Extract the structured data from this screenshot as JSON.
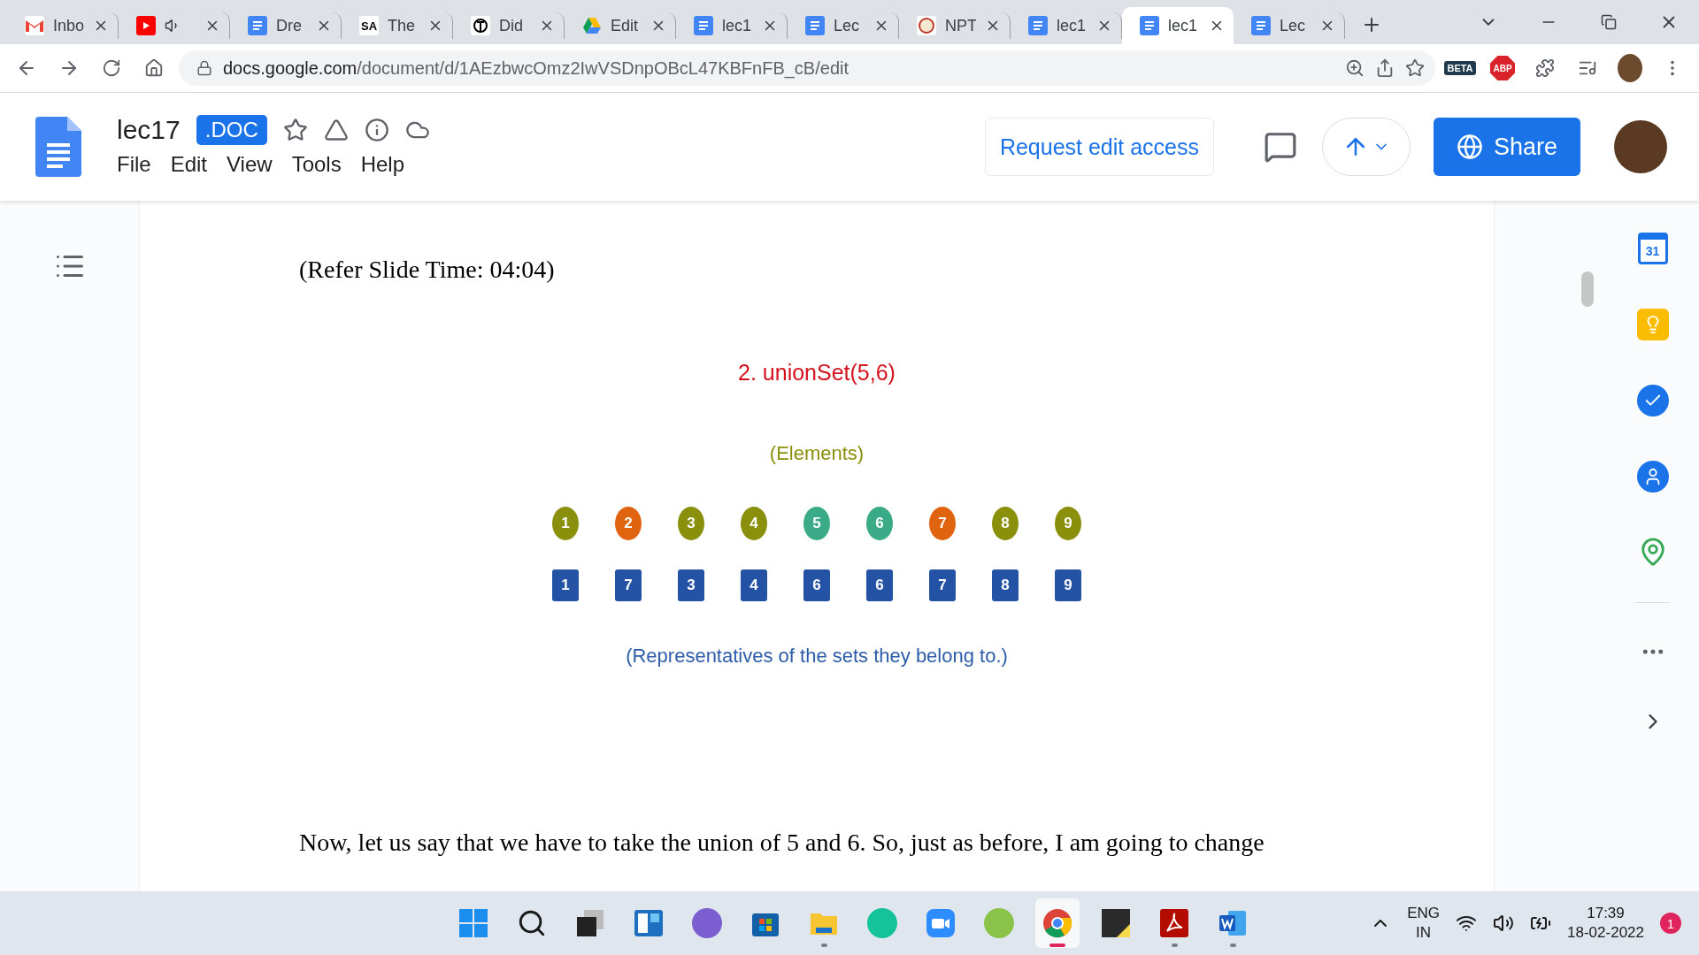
{
  "tabs": [
    {
      "kind": "gmail",
      "label": "Inbo",
      "audio": false,
      "selected": false
    },
    {
      "kind": "youtube",
      "audio": true,
      "selected": false
    },
    {
      "kind": "docs",
      "label": "Dre",
      "audio": false,
      "selected": false
    },
    {
      "kind": "sa",
      "icon_text": "SA",
      "label": "The",
      "audio": false,
      "selected": false
    },
    {
      "kind": "nyt",
      "label": "Did",
      "audio": false,
      "selected": false
    },
    {
      "kind": "drive",
      "label": "Edit",
      "audio": false,
      "selected": false
    },
    {
      "kind": "docs",
      "label": "lec1",
      "audio": false,
      "selected": false
    },
    {
      "kind": "docs",
      "label": "Lec",
      "audio": false,
      "selected": false
    },
    {
      "kind": "nptel",
      "label": "NPT",
      "audio": false,
      "selected": false
    },
    {
      "kind": "docs",
      "label": "lec1",
      "audio": false,
      "selected": false
    },
    {
      "kind": "docs",
      "label": "lec1",
      "audio": false,
      "selected": true
    },
    {
      "kind": "docs",
      "label": "Lec",
      "audio": false,
      "selected": false
    }
  ],
  "address_bar": {
    "host": "docs.google.com",
    "path": "/document/d/1AEzbwcOmz2IwVSDnpOBcL47KBFnFB_cB/edit"
  },
  "extensions": {
    "beta_label": "BETA",
    "abp_label": "ABP"
  },
  "doc_header": {
    "title": "lec17",
    "badge": ".DOC",
    "menu": [
      "File",
      "Edit",
      "View",
      "Tools",
      "Help"
    ],
    "request_button": "Request edit access",
    "share_button": "Share"
  },
  "document": {
    "refer": "(Refer Slide Time: 04:04)",
    "slide": {
      "title": "2. unionSet(5,6)",
      "elements_label": "(Elements)",
      "elements": [
        {
          "label": "1",
          "color": "#8a8f0c"
        },
        {
          "label": "2",
          "color": "#e0630f"
        },
        {
          "label": "3",
          "color": "#8a8f0c"
        },
        {
          "label": "4",
          "color": "#8a8f0c"
        },
        {
          "label": "5",
          "color": "#3aab86"
        },
        {
          "label": "6",
          "color": "#3aab86"
        },
        {
          "label": "7",
          "color": "#e0630f"
        },
        {
          "label": "8",
          "color": "#8a8f0c"
        },
        {
          "label": "9",
          "color": "#8a8f0c"
        }
      ],
      "representatives": [
        "1",
        "7",
        "3",
        "4",
        "6",
        "6",
        "7",
        "8",
        "9"
      ],
      "caption": "(Representatives of the sets they belong to.)"
    },
    "paragraph": [
      "Now, let us say that we have to take the union of 5 and 6. So, just as before, I am going to change"
    ]
  },
  "side_panel": {
    "calendar_day": "31"
  },
  "taskbar": {
    "apps": [
      {
        "kind": "start",
        "open": false,
        "selected": false
      },
      {
        "kind": "search",
        "open": false,
        "selected": false
      },
      {
        "kind": "taskview",
        "open": false,
        "selected": false
      },
      {
        "kind": "widgets",
        "open": false,
        "selected": false
      },
      {
        "kind": "chat",
        "open": false,
        "selected": false
      },
      {
        "kind": "store",
        "open": false,
        "selected": false
      },
      {
        "kind": "explorer",
        "open": true,
        "selected": false
      },
      {
        "kind": "grammarly",
        "open": false,
        "selected": false
      },
      {
        "kind": "zoom",
        "open": false,
        "selected": false
      },
      {
        "kind": "leaf",
        "open": false,
        "selected": false
      },
      {
        "kind": "chrome",
        "open": true,
        "selected": true
      },
      {
        "kind": "sticky",
        "open": false,
        "selected": false
      },
      {
        "kind": "acrobat",
        "open": true,
        "selected": false
      },
      {
        "kind": "word",
        "open": true,
        "selected": false
      }
    ],
    "language": "ENG",
    "region": "IN",
    "time": "17:39",
    "date": "18-02-2022",
    "notifications": "1"
  }
}
